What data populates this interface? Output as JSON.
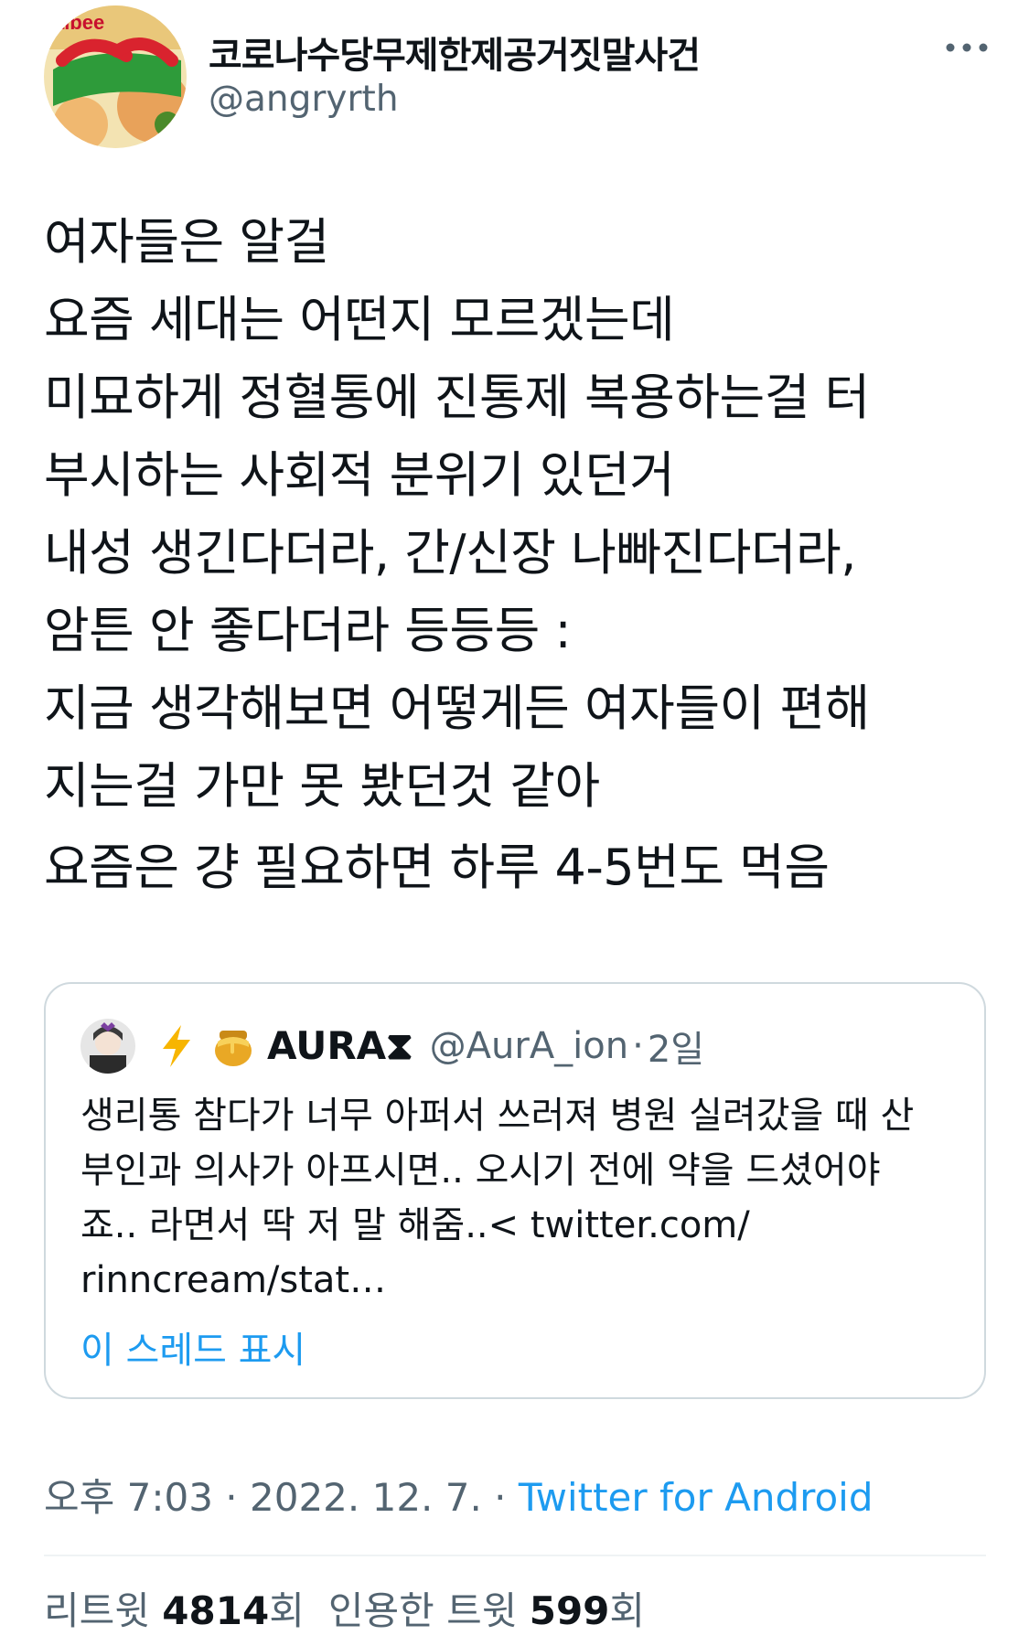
{
  "author": {
    "display_name": "코로나수당무제한제공거짓말사건",
    "handle": "@angryrth",
    "avatar_icon": "snack-package-avatar",
    "avatar_text": "albee"
  },
  "menu": {
    "more_icon": "more-horizontal-icon"
  },
  "tweet": {
    "lines_para1": "여자들은 알걸\n요즘 세대는 어떤지 모르겠는데\n미묘하게 정혈통에 진통제 복용하는걸 터\n부시하는 사회적 분위기 있던거\n내성 생긴다더라, 간/신장 나빠진다더라,\n암튼 안 좋다더라 등등등 :\n지금 생각해보면 어떻게든 여자들이 편해\n지는걸 가만 못 봤던것 같아",
    "lines_para2": "요즘은 걍 필요하면 하루 4-5번도 먹음"
  },
  "quote": {
    "avatar_icon": "anime-character-avatar",
    "emoji1": "lightning-icon",
    "emoji2": "honey-pot-icon",
    "name": "AURA⧗",
    "handle": "@AurA_ion",
    "separator": "·",
    "time": "2일",
    "text": "생리통 참다가 너무 아퍼서 쓰러져 병원 실려갔을 때 산\n부인과 의사가 아프시면.. 오시기 전에 약을 드셨어야\n죠.. 라면서 딱 저 말 해줌..< twitter.com/\nrinncream/stat…",
    "show_thread": "이 스레드 표시"
  },
  "meta": {
    "time": "오후 7:03",
    "dot1": " · ",
    "date": "2022. 12. 7.",
    "dot2": " · ",
    "source": "Twitter for Android"
  },
  "stats": {
    "retweets_label": "리트윗 ",
    "retweets_count": "4814",
    "retweets_suffix": "회",
    "quotes_label": "인용한 트윗 ",
    "quotes_count": "599",
    "quotes_suffix": "회"
  },
  "colors": {
    "text": "#0f1419",
    "secondary": "#536471",
    "link": "#1d9bf0",
    "border": "#cfd9de"
  }
}
